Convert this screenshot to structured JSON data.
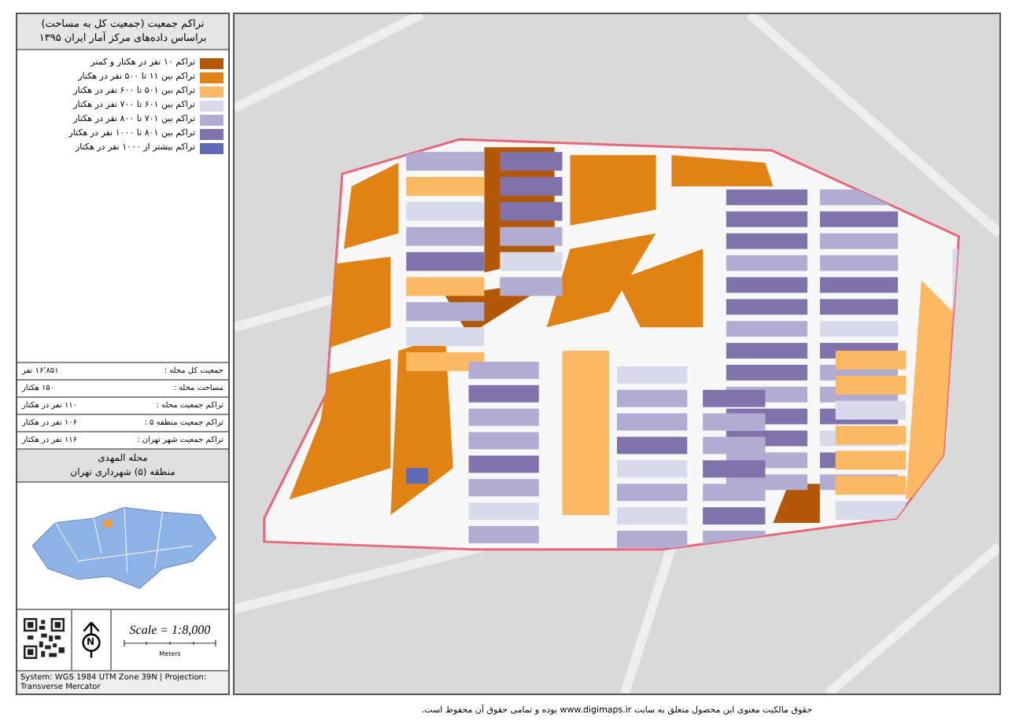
{
  "legend": {
    "title": "تراکم جمعیت (جمعیت کل به مساحت)",
    "subtitle": "براساس داده‌های مرکز آمار ایران ۱۳۹۵",
    "items": [
      {
        "label": "تراکم ۱۰ نفر در هکتار و کمتر",
        "color": "#b35806"
      },
      {
        "label": "تراکم بین ۱۱ تا ۵۰۰ نفر در هکتار",
        "color": "#e08214"
      },
      {
        "label": "تراکم بین ۵۰۱ تا ۶۰۰ نفر در هکتار",
        "color": "#fdb863"
      },
      {
        "label": "تراکم بین ۶۰۱ تا ۷۰۰ نفر در هکتار",
        "color": "#d8daeb"
      },
      {
        "label": "تراکم بین ۷۰۱ تا ۸۰۰ نفر در هکتار",
        "color": "#b2abd2"
      },
      {
        "label": "تراکم بین ۸۰۱ تا ۱۰۰۰ نفر در هکتار",
        "color": "#8073ac"
      },
      {
        "label": "تراکم بیشتر از ۱۰۰۰ نفر در هکتار",
        "color": "#5e6ab8"
      }
    ]
  },
  "stats": [
    {
      "label": "جمعیت کل محله :",
      "value": "۱۶٬۸۵۱ نفر"
    },
    {
      "label": "مساحت محله :",
      "value": "۱۵۰ هکتار"
    },
    {
      "label": "تراکم جمعیت محله :",
      "value": "۱۱۰ نفر در هکتار"
    },
    {
      "label": "تراکم جمعیت منطقه ۵ :",
      "value": "۱۰۶ نفر در هکتار"
    },
    {
      "label": "تراکم جمعیت شهر تهران :",
      "value": "۱۱۶ نفر در هکتار"
    }
  ],
  "place": {
    "neighborhood": "محله المهدی",
    "district": "منطقه (۵) شهرداری تهران"
  },
  "north_label": "N",
  "scale": "Scale = 1:8,000",
  "scale_unit": "Meters",
  "datum": "System: WGS 1984 UTM Zone 39N | Projection: Transverse Mercator",
  "copyright": "حقوق مالکیت معنوی این محصول متعلق به سایت www.digimaps.ir بوده و تمامی حقوق آن محفوظ است."
}
